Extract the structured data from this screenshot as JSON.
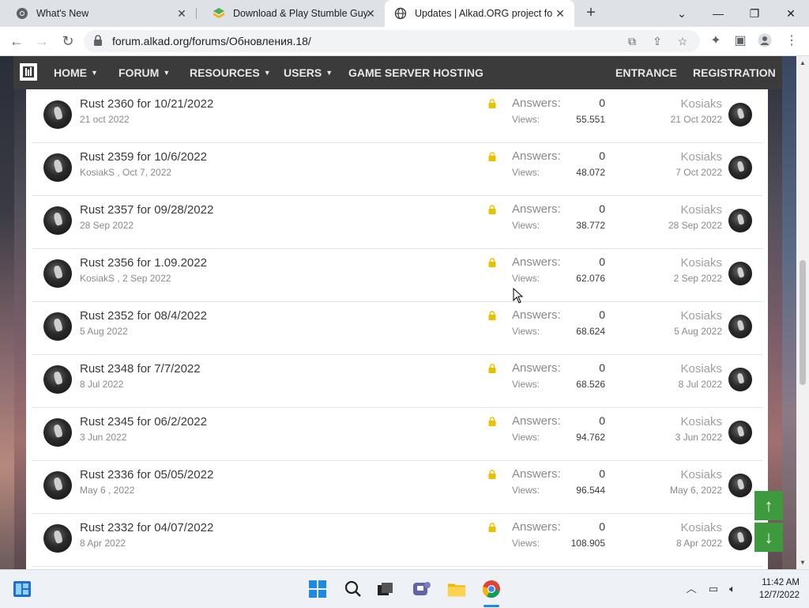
{
  "browser": {
    "tabs": [
      {
        "title": "What's New",
        "icon": "chrome-icon",
        "active": false
      },
      {
        "title": "Download & Play Stumble Guys",
        "icon": "bluestacks-icon",
        "active": false
      },
      {
        "title": "Updates | Alkad.ORG project foru",
        "icon": "globe-icon",
        "active": true
      }
    ],
    "url": "forum.alkad.org/forums/Обновления.18/"
  },
  "site_nav": {
    "left": [
      {
        "label": "HOME",
        "dropdown": true
      },
      {
        "label": "FORUM",
        "dropdown": true
      },
      {
        "label": "RESOURCES",
        "dropdown": true
      },
      {
        "label": "USERS",
        "dropdown": true
      },
      {
        "label": "GAME SERVER HOSTING",
        "dropdown": false
      }
    ],
    "right": [
      {
        "label": "ENTRANCE"
      },
      {
        "label": "REGISTRATION"
      }
    ]
  },
  "threads": [
    {
      "title": "Rust 2360 for 10/21/2022",
      "meta": "21 oct 2022",
      "answers_label": "Answers:",
      "answers": "0",
      "views_label": "Views:",
      "views": "55.551",
      "author": "Kosiaks",
      "date": "21 Oct 2022"
    },
    {
      "title": "Rust 2359 for 10/6/2022",
      "meta": "KosiakS , Oct 7, 2022",
      "answers_label": "Answers:",
      "answers": "0",
      "views_label": "Views:",
      "views": "48.072",
      "author": "Kosiaks",
      "date": "7 Oct 2022"
    },
    {
      "title": "Rust 2357 for 09/28/2022",
      "meta": "28 Sep 2022",
      "answers_label": "Answers:",
      "answers": "0",
      "views_label": "Views:",
      "views": "38.772",
      "author": "Kosiaks",
      "date": "28 Sep 2022"
    },
    {
      "title": "Rust 2356 for 1.09.2022",
      "meta": "KosiakS , 2 Sep 2022",
      "answers_label": "Answers:",
      "answers": "0",
      "views_label": "Views:",
      "views": "62.076",
      "author": "Kosiaks",
      "date": "2 Sep 2022"
    },
    {
      "title": "Rust 2352 for 08/4/2022",
      "meta": "5 Aug 2022",
      "answers_label": "Answers:",
      "answers": "0",
      "views_label": "Views:",
      "views": "68.624",
      "author": "Kosiaks",
      "date": "5 Aug 2022"
    },
    {
      "title": "Rust 2348 for 7/7/2022",
      "meta": "8 Jul 2022",
      "answers_label": "Answers:",
      "answers": "0",
      "views_label": "Views:",
      "views": "68.526",
      "author": "Kosiaks",
      "date": "8 Jul 2022"
    },
    {
      "title": "Rust 2345 for 06/2/2022",
      "meta": "3 Jun 2022",
      "answers_label": "Answers:",
      "answers": "0",
      "views_label": "Views:",
      "views": "94.762",
      "author": "Kosiaks",
      "date": "3 Jun 2022"
    },
    {
      "title": "Rust 2336 for 05/05/2022",
      "meta": "May 6 , 2022",
      "answers_label": "Answers:",
      "answers": "0",
      "views_label": "Views:",
      "views": "96.544",
      "author": "Kosiaks",
      "date": "May 6, 2022"
    },
    {
      "title": "Rust 2332 for 04/07/2022",
      "meta": "8 Apr 2022",
      "answers_label": "Answers:",
      "answers": "0",
      "views_label": "Views:",
      "views": "108.905",
      "author": "Kosiaks",
      "date": "8 Apr 2022"
    }
  ],
  "scroll_buttons": {
    "up": "↑",
    "down": "↓"
  },
  "taskbar": {
    "time": "11:42 AM",
    "date": "12/7/2022"
  },
  "colors": {
    "nav_bg": "#3b3b3b",
    "lock": "#e6c200",
    "scroll_btn": "#3d9a3d"
  }
}
